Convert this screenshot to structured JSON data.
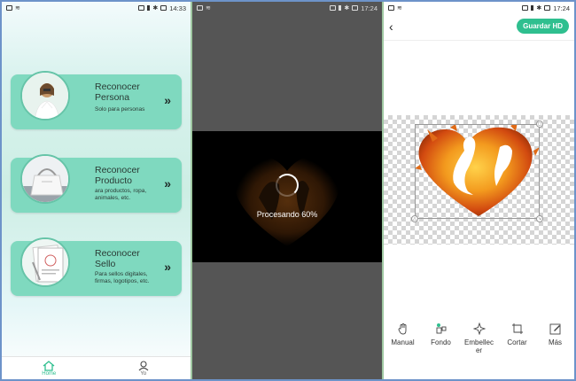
{
  "screen1": {
    "status": {
      "time": "14:33"
    },
    "cards": [
      {
        "title": "Reconocer Persona",
        "subtitle": "Solo para personas"
      },
      {
        "title": "Reconocer Producto",
        "subtitle": "ara productos, ropa, animales, etc."
      },
      {
        "title": "Reconocer Sello",
        "subtitle": "Para sellos digitales, firmas, logotipos, etc."
      }
    ],
    "nav": {
      "home_label": "Home",
      "me_label": "Yo"
    }
  },
  "screen2": {
    "status": {
      "time": "17:24"
    },
    "processing_text": "Procesando 60%",
    "progress": 0.6
  },
  "screen3": {
    "status": {
      "time": "17:24"
    },
    "save_label": "Guardar HD",
    "tools": [
      {
        "label": "Manual",
        "icon": "hand-icon"
      },
      {
        "label": "Fondo",
        "icon": "background-icon"
      },
      {
        "label": "Embellecer",
        "icon": "sparkle-icon"
      },
      {
        "label": "Cortar",
        "icon": "crop-icon"
      },
      {
        "label": "Más",
        "icon": "edit-icon"
      }
    ]
  },
  "colors": {
    "accent": "#2fbf8f",
    "card": "#7fd9bf"
  }
}
